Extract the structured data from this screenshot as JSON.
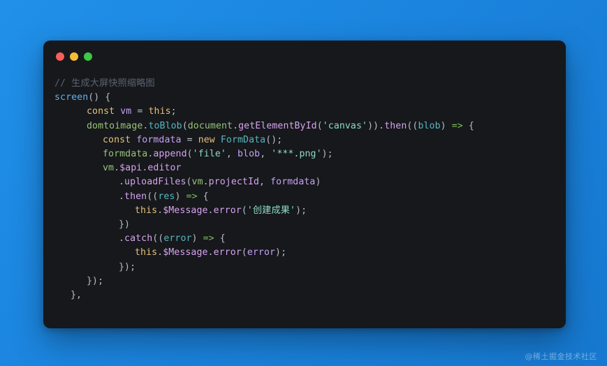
{
  "window": {
    "background_color": "#1b84de",
    "panel_color": "#16181b",
    "controls": [
      {
        "name": "close",
        "color": "#f4605a"
      },
      {
        "name": "minimize",
        "color": "#f5bd37"
      },
      {
        "name": "maximize",
        "color": "#3ec645"
      }
    ]
  },
  "code": {
    "language": "javascript",
    "lines": [
      {
        "indent": 0,
        "tokens": [
          {
            "t": "// 生成大屏快照缩略图",
            "c": "t-comment"
          }
        ]
      },
      {
        "indent": 0,
        "tokens": [
          {
            "t": "screen",
            "c": "t-fn"
          },
          {
            "t": "() {",
            "c": "t-punc"
          }
        ]
      },
      {
        "indent": 4,
        "tokens": [
          {
            "t": "const",
            "c": "t-kw"
          },
          {
            "t": " ",
            "c": "t-plain"
          },
          {
            "t": "vm",
            "c": "t-var"
          },
          {
            "t": " ",
            "c": "t-plain"
          },
          {
            "t": "=",
            "c": "t-punc"
          },
          {
            "t": " ",
            "c": "t-plain"
          },
          {
            "t": "this",
            "c": "t-kw"
          },
          {
            "t": ";",
            "c": "t-punc"
          }
        ]
      },
      {
        "indent": 4,
        "tokens": [
          {
            "t": "domtoimage",
            "c": "t-obj"
          },
          {
            "t": ".",
            "c": "t-punc"
          },
          {
            "t": "toBlob",
            "c": "t-param"
          },
          {
            "t": "(",
            "c": "t-punc"
          },
          {
            "t": "document",
            "c": "t-obj"
          },
          {
            "t": ".",
            "c": "t-punc"
          },
          {
            "t": "getElementById",
            "c": "t-prop"
          },
          {
            "t": "(",
            "c": "t-punc"
          },
          {
            "t": "'canvas'",
            "c": "t-str"
          },
          {
            "t": "))",
            "c": "t-punc"
          },
          {
            "t": ".",
            "c": "t-punc"
          },
          {
            "t": "then",
            "c": "t-prop"
          },
          {
            "t": "((",
            "c": "t-punc"
          },
          {
            "t": "blob",
            "c": "t-param"
          },
          {
            "t": ") ",
            "c": "t-punc"
          },
          {
            "t": "=>",
            "c": "t-arrow"
          },
          {
            "t": " {",
            "c": "t-punc"
          }
        ]
      },
      {
        "indent": 6,
        "tokens": [
          {
            "t": "const",
            "c": "t-kw"
          },
          {
            "t": " ",
            "c": "t-plain"
          },
          {
            "t": "formdata",
            "c": "t-var"
          },
          {
            "t": " ",
            "c": "t-plain"
          },
          {
            "t": "=",
            "c": "t-punc"
          },
          {
            "t": " ",
            "c": "t-plain"
          },
          {
            "t": "new",
            "c": "t-kw"
          },
          {
            "t": " ",
            "c": "t-plain"
          },
          {
            "t": "FormData",
            "c": "t-param"
          },
          {
            "t": "();",
            "c": "t-punc"
          }
        ]
      },
      {
        "indent": 6,
        "tokens": [
          {
            "t": "formdata",
            "c": "t-obj"
          },
          {
            "t": ".",
            "c": "t-punc"
          },
          {
            "t": "append",
            "c": "t-prop"
          },
          {
            "t": "(",
            "c": "t-punc"
          },
          {
            "t": "'file'",
            "c": "t-str"
          },
          {
            "t": ", ",
            "c": "t-punc"
          },
          {
            "t": "blob",
            "c": "t-var"
          },
          {
            "t": ", ",
            "c": "t-punc"
          },
          {
            "t": "'***.png'",
            "c": "t-str"
          },
          {
            "t": ");",
            "c": "t-punc"
          }
        ]
      },
      {
        "indent": 6,
        "tokens": [
          {
            "t": "vm",
            "c": "t-obj"
          },
          {
            "t": ".",
            "c": "t-punc"
          },
          {
            "t": "$api",
            "c": "t-prop"
          },
          {
            "t": ".",
            "c": "t-punc"
          },
          {
            "t": "editor",
            "c": "t-prop"
          }
        ]
      },
      {
        "indent": 8,
        "tokens": [
          {
            "t": ".",
            "c": "t-punc"
          },
          {
            "t": "uploadFiles",
            "c": "t-prop"
          },
          {
            "t": "(",
            "c": "t-punc"
          },
          {
            "t": "vm",
            "c": "t-obj"
          },
          {
            "t": ".",
            "c": "t-punc"
          },
          {
            "t": "projectId",
            "c": "t-prop"
          },
          {
            "t": ", ",
            "c": "t-punc"
          },
          {
            "t": "formdata",
            "c": "t-var"
          },
          {
            "t": ")",
            "c": "t-punc"
          }
        ]
      },
      {
        "indent": 8,
        "tokens": [
          {
            "t": ".",
            "c": "t-punc"
          },
          {
            "t": "then",
            "c": "t-prop"
          },
          {
            "t": "((",
            "c": "t-punc"
          },
          {
            "t": "res",
            "c": "t-param"
          },
          {
            "t": ") ",
            "c": "t-punc"
          },
          {
            "t": "=>",
            "c": "t-arrow"
          },
          {
            "t": " {",
            "c": "t-punc"
          }
        ]
      },
      {
        "indent": 10,
        "tokens": [
          {
            "t": "this",
            "c": "t-kw"
          },
          {
            "t": ".",
            "c": "t-punc"
          },
          {
            "t": "$Message",
            "c": "t-prop"
          },
          {
            "t": ".",
            "c": "t-punc"
          },
          {
            "t": "error",
            "c": "t-prop"
          },
          {
            "t": "(",
            "c": "t-punc"
          },
          {
            "t": "'创建成果'",
            "c": "t-str"
          },
          {
            "t": ");",
            "c": "t-punc"
          }
        ]
      },
      {
        "indent": 8,
        "tokens": [
          {
            "t": "})",
            "c": "t-punc"
          }
        ]
      },
      {
        "indent": 8,
        "tokens": [
          {
            "t": ".",
            "c": "t-punc"
          },
          {
            "t": "catch",
            "c": "t-prop"
          },
          {
            "t": "((",
            "c": "t-punc"
          },
          {
            "t": "error",
            "c": "t-param"
          },
          {
            "t": ") ",
            "c": "t-punc"
          },
          {
            "t": "=>",
            "c": "t-arrow"
          },
          {
            "t": " {",
            "c": "t-punc"
          }
        ]
      },
      {
        "indent": 10,
        "tokens": [
          {
            "t": "this",
            "c": "t-kw"
          },
          {
            "t": ".",
            "c": "t-punc"
          },
          {
            "t": "$Message",
            "c": "t-prop"
          },
          {
            "t": ".",
            "c": "t-punc"
          },
          {
            "t": "error",
            "c": "t-prop"
          },
          {
            "t": "(",
            "c": "t-punc"
          },
          {
            "t": "error",
            "c": "t-var"
          },
          {
            "t": ");",
            "c": "t-punc"
          }
        ]
      },
      {
        "indent": 8,
        "tokens": [
          {
            "t": "});",
            "c": "t-punc"
          }
        ]
      },
      {
        "indent": 4,
        "tokens": [
          {
            "t": "});",
            "c": "t-punc"
          }
        ]
      },
      {
        "indent": 2,
        "tokens": [
          {
            "t": "},",
            "c": "t-punc"
          }
        ]
      }
    ]
  },
  "watermark": {
    "text": "@稀土掘金技术社区"
  }
}
